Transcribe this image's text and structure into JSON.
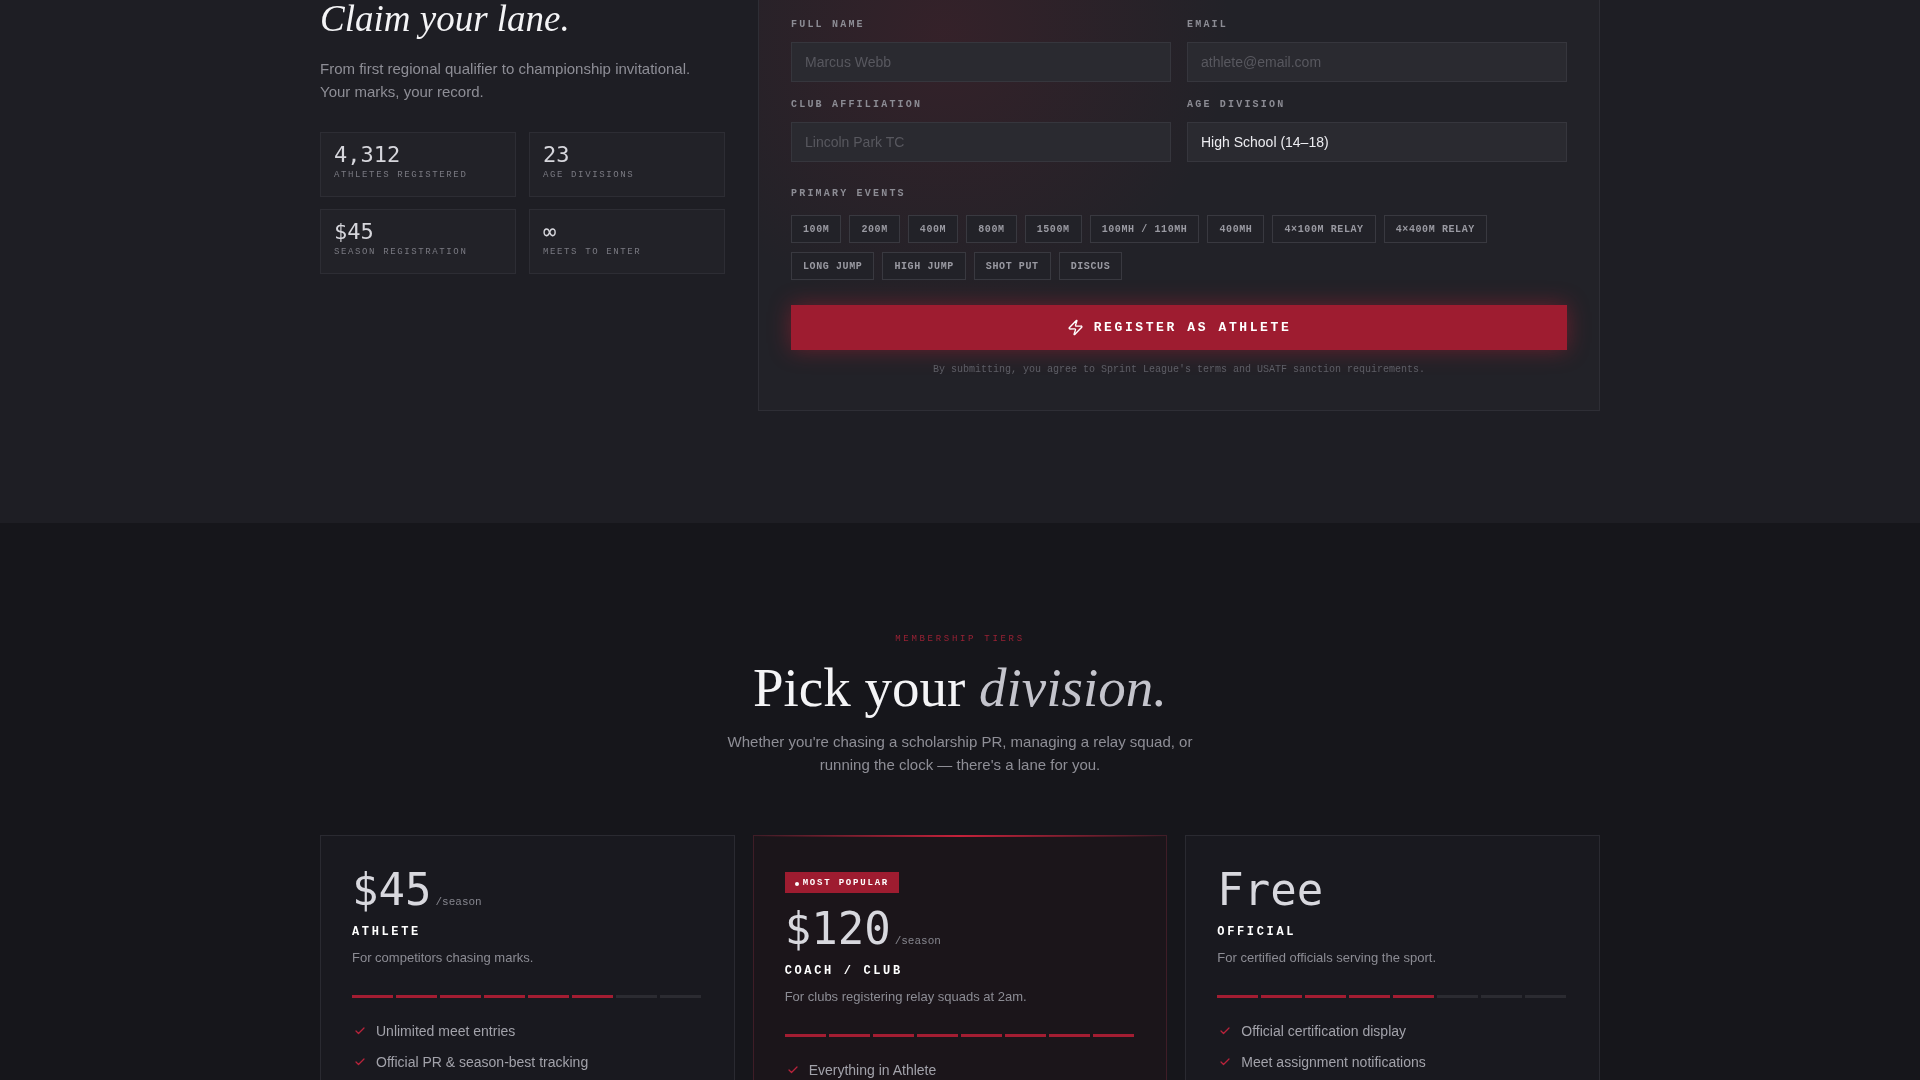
{
  "hero": {
    "title": "Claim your lane.",
    "description": "From first regional qualifier to championship invitational. Your marks, your record.",
    "stats": [
      {
        "value": "4,312",
        "label": "ATHLETES REGISTERED"
      },
      {
        "value": "23",
        "label": "AGE DIVISIONS"
      },
      {
        "value": "$45",
        "label": "SEASON REGISTRATION"
      },
      {
        "value": "∞",
        "label": "MEETS TO ENTER"
      }
    ]
  },
  "registration": {
    "fields": [
      {
        "kind": "text",
        "label": "FULL NAME",
        "placeholder": "Marcus Webb"
      },
      {
        "kind": "text",
        "label": "EMAIL",
        "placeholder": "athlete@email.com"
      },
      {
        "kind": "text",
        "label": "CLUB AFFILIATION",
        "placeholder": "Lincoln Park TC"
      },
      {
        "kind": "select",
        "label": "AGE DIVISION",
        "value": "High School (14–18)"
      }
    ],
    "events_label": "PRIMARY EVENTS",
    "events": [
      {
        "label": "100M",
        "selected": false
      },
      {
        "label": "200M",
        "selected": false
      },
      {
        "label": "400M",
        "selected": false
      },
      {
        "label": "800M",
        "selected": false
      },
      {
        "label": "1500M",
        "selected": false
      },
      {
        "label": "100MH / 110MH",
        "selected": false
      },
      {
        "label": "400MH",
        "selected": false
      },
      {
        "label": "4×100M RELAY",
        "selected": false
      },
      {
        "label": "4×400M RELAY",
        "selected": false
      },
      {
        "label": "LONG JUMP",
        "selected": false
      },
      {
        "label": "HIGH JUMP",
        "selected": false
      },
      {
        "label": "SHOT PUT",
        "selected": false
      },
      {
        "label": "DISCUS",
        "selected": false
      }
    ],
    "submit": "REGISTER AS ATHLETE",
    "terms": "By submitting, you agree to Sprint League's terms and USATF sanction requirements."
  },
  "pricing": {
    "eyebrow": "MEMBERSHIP TIERS",
    "title": "Pick your *division.*",
    "subtitle": "Whether you're chasing a scholarship PR, managing a relay squad, or running the clock — there's a lane for you.",
    "tiers": [
      {
        "featured": false,
        "price": "$45",
        "period": "/season",
        "name": "ATHLETE",
        "description": "For competitors chasing marks.",
        "level": 0.75,
        "features": [
          "Unlimited meet entries",
          "Official PR & season-best tracking"
        ]
      },
      {
        "featured": true,
        "badge": "MOST POPULAR",
        "price": "$120",
        "period": "/season",
        "name": "COACH / CLUB",
        "description": "For clubs registering relay squads at 2am.",
        "level": 1,
        "features": [
          "Everything in Athlete"
        ]
      },
      {
        "featured": false,
        "price": "Free",
        "name": "OFFICIAL",
        "description": "For certified officials serving the sport.",
        "level": 0.625,
        "features": [
          "Official certification display",
          "Meet assignment notifications"
        ]
      }
    ]
  }
}
